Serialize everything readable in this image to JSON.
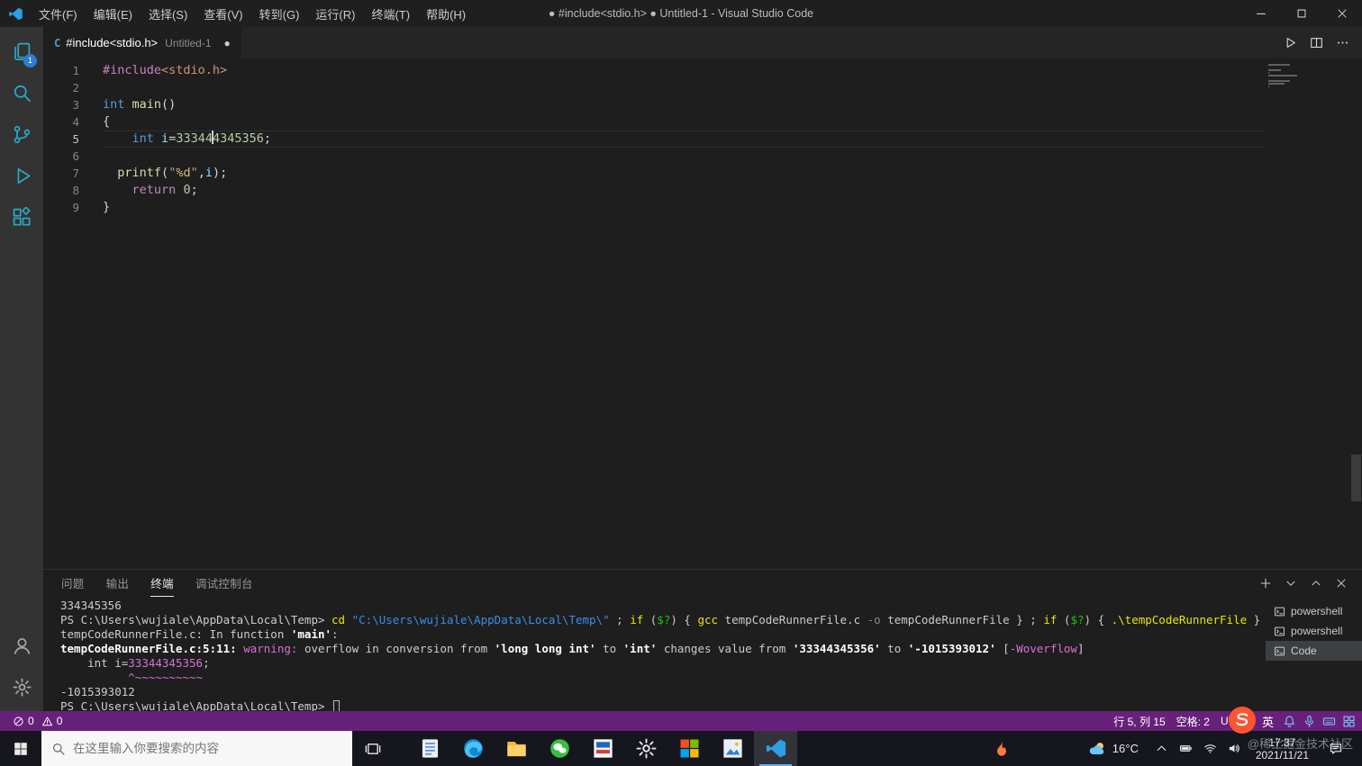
{
  "title_bar": {
    "title": "● #include<stdio.h> ● Untitled-1 - Visual Studio Code",
    "menus": [
      "文件(F)",
      "编辑(E)",
      "选择(S)",
      "查看(V)",
      "转到(G)",
      "运行(R)",
      "终端(T)",
      "帮助(H)"
    ],
    "window_controls": [
      {
        "name": "minimize-button",
        "icon": "minimize"
      },
      {
        "name": "maximize-button",
        "icon": "maximize"
      },
      {
        "name": "close-button",
        "icon": "close"
      }
    ]
  },
  "activity_bar": {
    "items": [
      {
        "name": "explorer",
        "icon": "files",
        "badge": "1"
      },
      {
        "name": "search",
        "icon": "search"
      },
      {
        "name": "source-control",
        "icon": "git"
      },
      {
        "name": "run-and-debug",
        "icon": "debug"
      },
      {
        "name": "extensions",
        "icon": "ext"
      }
    ],
    "bottom_items": [
      {
        "name": "accounts",
        "icon": "account"
      },
      {
        "name": "manage",
        "icon": "gear"
      }
    ]
  },
  "tab": {
    "file_icon": "C",
    "label": "#include<stdio.h>",
    "description": "Untitled-1",
    "dot": "●"
  },
  "tab_bar": {
    "actions": [
      {
        "name": "run-file",
        "icon": "play"
      },
      {
        "name": "split-editor",
        "icon": "split"
      },
      {
        "name": "more-actions",
        "icon": "more"
      }
    ]
  },
  "editor": {
    "lines": [
      {
        "n": "1",
        "tokens": [
          [
            "#include",
            "pp"
          ],
          [
            "<stdio.h>",
            "inc"
          ]
        ]
      },
      {
        "n": "2",
        "tokens": []
      },
      {
        "n": "3",
        "tokens": [
          [
            "int",
            "kw"
          ],
          [
            " ",
            "def"
          ],
          [
            "main",
            "fn"
          ],
          [
            "()",
            "def"
          ]
        ]
      },
      {
        "n": "4",
        "tokens": [
          [
            "{",
            "def"
          ]
        ]
      },
      {
        "n": "5",
        "cur": true,
        "tokens": [
          [
            "    ",
            "def"
          ],
          [
            "int",
            "kw"
          ],
          [
            " ",
            "def"
          ],
          [
            "i",
            "var"
          ],
          [
            "=",
            "def"
          ],
          [
            "33344",
            "num"
          ],
          [
            "",
            "cursor"
          ],
          [
            "4345356",
            "num"
          ],
          [
            ";",
            "def"
          ]
        ]
      },
      {
        "n": "6",
        "tokens": []
      },
      {
        "n": "7",
        "tokens": [
          [
            "  ",
            "def"
          ],
          [
            "printf",
            "fn"
          ],
          [
            "(",
            "def"
          ],
          [
            "\"",
            "str"
          ],
          [
            "%d",
            "fmt"
          ],
          [
            "\"",
            "str"
          ],
          [
            ",",
            "def"
          ],
          [
            "i",
            "var"
          ],
          [
            ")",
            "def"
          ],
          [
            ";",
            "def"
          ]
        ]
      },
      {
        "n": "8",
        "tokens": [
          [
            "    ",
            "def"
          ],
          [
            "return",
            "ctl"
          ],
          [
            " ",
            "def"
          ],
          [
            "0",
            "num"
          ],
          [
            ";",
            "def"
          ]
        ]
      },
      {
        "n": "9",
        "tokens": [
          [
            "}",
            "def"
          ]
        ]
      }
    ]
  },
  "panel": {
    "tabs": [
      {
        "name": "problems",
        "label": "问题",
        "active": false
      },
      {
        "name": "output",
        "label": "输出",
        "active": false
      },
      {
        "name": "terminal",
        "label": "终端",
        "active": true
      },
      {
        "name": "debug-console",
        "label": "调试控制台",
        "active": false
      }
    ],
    "actions": [
      {
        "name": "new-terminal",
        "icon": "plus"
      },
      {
        "name": "terminal-profiles",
        "icon": "chevdown"
      },
      {
        "name": "maximize-panel",
        "icon": "chevup"
      },
      {
        "name": "close-panel",
        "icon": "close"
      }
    ]
  },
  "terminal": {
    "lines": [
      {
        "tokens": [
          [
            "334345356",
            "def"
          ]
        ]
      },
      {
        "tokens": [
          [
            "PS C:\\Users\\wujiale\\AppData\\Local\\Temp> ",
            "def"
          ],
          [
            "cd",
            "cmd"
          ],
          [
            " ",
            "def"
          ],
          [
            "\"C:\\Users\\wujiale\\AppData\\Local\\Temp\\\"",
            "str"
          ],
          [
            " ; ",
            "def"
          ],
          [
            "if",
            "cmd"
          ],
          [
            " (",
            "def"
          ],
          [
            "$?",
            "grn"
          ],
          [
            ") { ",
            "def"
          ],
          [
            "gcc",
            "cmd"
          ],
          [
            " tempCodeRunnerFile.c ",
            "def"
          ],
          [
            "-o",
            "dim"
          ],
          [
            " tempCodeRunnerFile } ; ",
            "def"
          ],
          [
            "if",
            "cmd"
          ],
          [
            " (",
            "def"
          ],
          [
            "$?",
            "grn"
          ],
          [
            ") { ",
            "def"
          ],
          [
            ".\\tempCodeRunnerFile",
            "cmd"
          ],
          [
            " }",
            "def"
          ]
        ]
      },
      {
        "tokens": [
          [
            "tempCodeRunnerFile.c: In function ",
            "def"
          ],
          [
            "'main'",
            "b"
          ],
          [
            ":",
            "def"
          ]
        ]
      },
      {
        "tokens": [
          [
            "tempCodeRunnerFile.c:5:11: ",
            "b"
          ],
          [
            "warning: ",
            "mag"
          ],
          [
            "overflow in conversion from ",
            "def"
          ],
          [
            "'long long int'",
            "b"
          ],
          [
            " to ",
            "def"
          ],
          [
            "'int'",
            "b"
          ],
          [
            " changes value from ",
            "def"
          ],
          [
            "'33344345356'",
            "b"
          ],
          [
            " to ",
            "def"
          ],
          [
            "'-1015393012'",
            "b"
          ],
          [
            " [",
            "def"
          ],
          [
            "-Woverflow",
            "mag"
          ],
          [
            "]",
            "def"
          ]
        ]
      },
      {
        "tokens": [
          [
            "    int i=",
            "def"
          ],
          [
            "33344345356",
            "mag"
          ],
          [
            ";",
            "def"
          ]
        ]
      },
      {
        "tokens": [
          [
            "          ",
            "def"
          ],
          [
            "^~~~~~~~~~~",
            "mag"
          ]
        ]
      },
      {
        "tokens": [
          [
            "-1015393012",
            "def"
          ]
        ]
      },
      {
        "tokens": [
          [
            "PS C:\\Users\\wujiale\\AppData\\Local\\Temp> ",
            "def"
          ],
          [
            "",
            "tcursor"
          ]
        ]
      }
    ],
    "sidebar": [
      {
        "label": "powershell",
        "icon": "term",
        "selected": false
      },
      {
        "label": "powershell",
        "icon": "term",
        "selected": false
      },
      {
        "label": "Code",
        "icon": "term",
        "selected": true
      }
    ]
  },
  "status_bar": {
    "problems": {
      "errors": "0",
      "warnings": "0"
    },
    "right_items": [
      {
        "name": "cursor-position",
        "label": "行 5, 列 15"
      },
      {
        "name": "indentation",
        "label": "空格: 2"
      },
      {
        "name": "encoding",
        "label": "UTF-8"
      }
    ],
    "ime_mode": "英",
    "ime_icons": [
      {
        "name": "notification-bell",
        "icon": "bell"
      },
      {
        "name": "microphone",
        "icon": "mic"
      },
      {
        "name": "soft-keyboard",
        "icon": "kbd"
      },
      {
        "name": "ime-toolbox",
        "icon": "grid4"
      }
    ]
  },
  "taskbar": {
    "start": {
      "name": "start-button",
      "icon": "win"
    },
    "search_placeholder": "在这里输入你要搜索的内容",
    "task_view": {
      "name": "task-view-button",
      "icon": "taskview"
    },
    "apps": [
      {
        "name": "notepad-app",
        "icon": "doc"
      },
      {
        "name": "edge-browser",
        "icon": "edge"
      },
      {
        "name": "file-explorer",
        "icon": "folder"
      },
      {
        "name": "wechat-app",
        "icon": "wechat"
      },
      {
        "name": "isp-app",
        "icon": "isp"
      },
      {
        "name": "settings-app",
        "icon": "gearapp"
      },
      {
        "name": "store-app",
        "icon": "store"
      },
      {
        "name": "photos-app",
        "icon": "photos"
      },
      {
        "name": "vscode-app",
        "icon": "vscode",
        "active": true
      }
    ],
    "security_app": {
      "name": "security-app",
      "icon": "fire"
    },
    "weather": {
      "temp": "16°C",
      "icon": "weather"
    },
    "tray": [
      {
        "name": "hidden-icons",
        "icon": "chevup"
      },
      {
        "name": "battery",
        "icon": "battery"
      },
      {
        "name": "network",
        "icon": "wifi"
      },
      {
        "name": "volume",
        "icon": "volume"
      }
    ],
    "clock": {
      "time": "17:37",
      "date": "2021/11/21"
    },
    "action_center": {
      "name": "action-center",
      "icon": "action"
    }
  },
  "overlay": {
    "watermark": "@稀土掘金技术社区",
    "logo_icon": "csdn"
  }
}
